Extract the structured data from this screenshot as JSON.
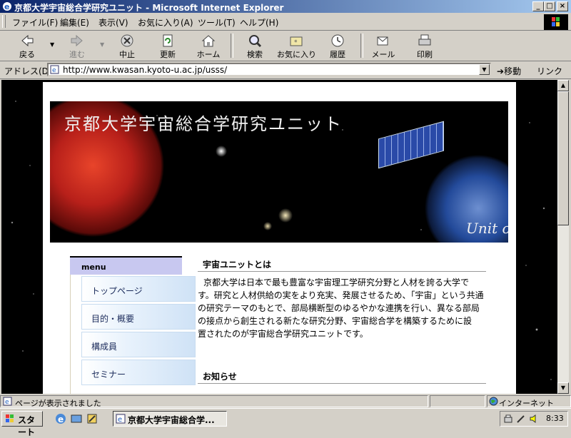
{
  "window": {
    "title": "京都大学宇宙総合学研究ユニット - Microsoft Internet Explorer",
    "minimize": "_",
    "maximize": "□",
    "close": "×"
  },
  "menubar": {
    "items": [
      "ファイル(F)",
      "編集(E)",
      "表示(V)",
      "お気に入り(A)",
      "ツール(T)",
      "ヘルプ(H)"
    ]
  },
  "toolbar": {
    "back": "戻る",
    "forward": "進む",
    "stop": "中止",
    "refresh": "更新",
    "home": "ホーム",
    "search": "検索",
    "favorites": "お気に入り",
    "history": "履歴",
    "mail": "メール",
    "print": "印刷"
  },
  "address": {
    "label": "アドレス(D)",
    "url": "http://www.kwasan.kyoto-u.ac.jp/usss/",
    "go": "移動",
    "links": "リンク"
  },
  "page": {
    "banner_title": "京都大学宇宙総合学研究ユニット",
    "banner_subtitle": "Unit o",
    "menu_header": "menu",
    "menu_items": [
      "トップページ",
      "目的・概要",
      "構成員",
      "セミナー"
    ],
    "section1_title": "宇宙ユニットとは",
    "section1_lines": [
      "京都大学は日本で最も豊富な宇宙理工学研究分野と人材を誇る大学で",
      "す。研究と人材供給の実をより充実、発展させるため、「宇宙」という共通",
      "の研究テーマのもとで、部局横断型のゆるやかな連携を行い、異なる部局",
      "の接点から創生される新たな研究分野、宇宙総合学を構築するために設",
      "置されたのが宇宙総合学研究ユニットです。"
    ],
    "section2_title": "お知らせ"
  },
  "status": {
    "message": "ページが表示されました",
    "zone": "インターネット"
  },
  "taskbar": {
    "start": "スタート",
    "task": "京都大学宇宙総合学...",
    "clock": "8:33"
  }
}
